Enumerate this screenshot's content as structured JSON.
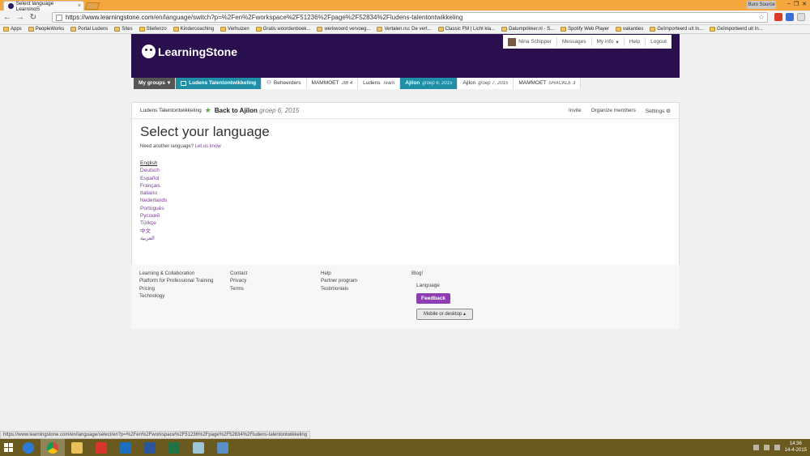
{
  "browser": {
    "tab_title": "Select language LearningS",
    "user_chip": "Buro Source",
    "url_host": "https://www.learningstone.com",
    "url_path": "/en/language/switch?p=%2Fen%2Fworkspace%2F51236%2Fpage%2F52834%2Fludens-talentontwikkeling",
    "bookmarks": [
      "Apps",
      "PeopleWorks",
      "Portal Ludens",
      "Sites",
      "Stiefenzo",
      "Kindercoaching",
      "Verhuizen",
      "Gratis woordenboek...",
      "werkwoord vervoeg...",
      "Vertalen.nu: De vert...",
      "Classic FM | Licht kla...",
      "Datumprikker.nl - S...",
      "Spotify Web Player",
      "vakanties",
      "Geïmporteerd uit In...",
      "Geïmporteerd uit In..."
    ]
  },
  "site": {
    "logo_text": "LearningStone",
    "user_menu": {
      "name": "Nina Schipper",
      "messages": "Messages",
      "my_info": "My info",
      "help": "Help",
      "logout": "Logout"
    }
  },
  "nav": {
    "my_groups": "My groups",
    "items": [
      {
        "label": "Ludens Talentontwikkeling",
        "sub": ""
      },
      {
        "label": "Beheerders",
        "sub": ""
      },
      {
        "label": "MAMMOET",
        "sub": "JIB 4"
      },
      {
        "label": "Ludens",
        "sub": "Team"
      },
      {
        "label": "Ajilon",
        "sub": "groep 6, 2015"
      },
      {
        "label": "Ajilon",
        "sub": "groep 7, 2015"
      },
      {
        "label": "MAMMOET",
        "sub": "SHACKLE 3"
      }
    ]
  },
  "card": {
    "crumb_group": "Ludens Talentontwikkeling",
    "back": "Back to Ajilon",
    "back_sub": "groep 6, 2015",
    "actions": {
      "invite": "Invite",
      "organize": "Organize members",
      "settings": "Settings"
    },
    "title": "Select your language",
    "another_prefix": "Need another language?",
    "another_link": "Let us know",
    "languages": [
      "English",
      "Deutsch",
      "Español",
      "Français",
      "Italiano",
      "Nederlands",
      "Português",
      "Русский",
      "Türkçe",
      "中文",
      "العربية"
    ]
  },
  "footer": {
    "col1": [
      "Learning & Collaboration",
      "Platform for Professional Training",
      "Pricing",
      "Technology"
    ],
    "col2": [
      "Contact",
      "Privacy",
      "Terms"
    ],
    "col3": [
      "Help",
      "Partner program",
      "Testimonials"
    ],
    "col4": [
      "Blog!"
    ],
    "language_label": "Language",
    "feedback": "Feedback",
    "mobile_desktop": "Mobile or desktop ▴"
  },
  "statusbar": "https://www.learningstone.com/en/language/select/en?p=%2Fen%2Fworkspace%2F51236%2Fpage%2F52834%2Fludens-talentontwikkeling",
  "taskbar": {
    "time": "14:36",
    "date": "14-4-2015"
  }
}
